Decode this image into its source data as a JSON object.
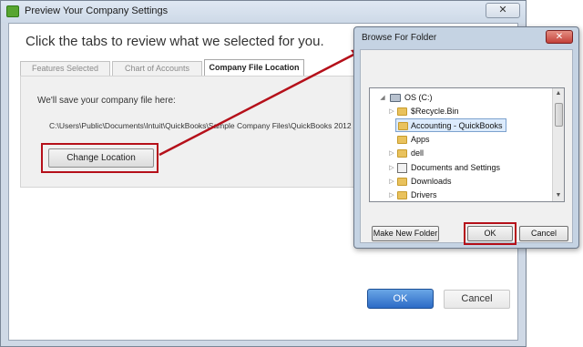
{
  "window": {
    "title": "Preview Your Company Settings",
    "close_label": "✕"
  },
  "heading": "Click the tabs to review what we selected for you.",
  "tabs": [
    {
      "label": "Features Selected",
      "active": false
    },
    {
      "label": "Chart of Accounts",
      "active": false
    },
    {
      "label": "Company File Location",
      "active": true
    }
  ],
  "location_panel": {
    "save_label": "We'll save your company file here:",
    "path": "C:\\Users\\Public\\Documents\\Intuit\\QuickBooks\\Sample Company Files\\QuickBooks 2012",
    "change_button": "Change Location"
  },
  "footer": {
    "ok_label": "OK",
    "cancel_label": "Cancel"
  },
  "browse_dialog": {
    "title": "Browse For Folder",
    "close_label": "✕",
    "tree": [
      {
        "label": "OS (C:)",
        "type": "drive",
        "expanded": true,
        "selected": false
      },
      {
        "label": "$Recycle.Bin",
        "type": "folder",
        "expanded": false,
        "selected": false
      },
      {
        "label": "Accounting - QuickBooks",
        "type": "folder",
        "expanded": false,
        "selected": true
      },
      {
        "label": "Apps",
        "type": "folder",
        "expanded": false,
        "selected": false
      },
      {
        "label": "dell",
        "type": "folder",
        "expanded": false,
        "selected": false
      },
      {
        "label": "Documents and Settings",
        "type": "shortcut",
        "expanded": false,
        "selected": false
      },
      {
        "label": "Downloads",
        "type": "folder",
        "expanded": false,
        "selected": false
      },
      {
        "label": "Drivers",
        "type": "folder",
        "expanded": false,
        "selected": false
      }
    ],
    "make_new_folder": "Make New Folder",
    "ok_label": "OK",
    "cancel_label": "Cancel"
  },
  "colors": {
    "highlight": "#b5101a",
    "primary_button": "#2c6bc6",
    "selection": "#dcebfc"
  }
}
